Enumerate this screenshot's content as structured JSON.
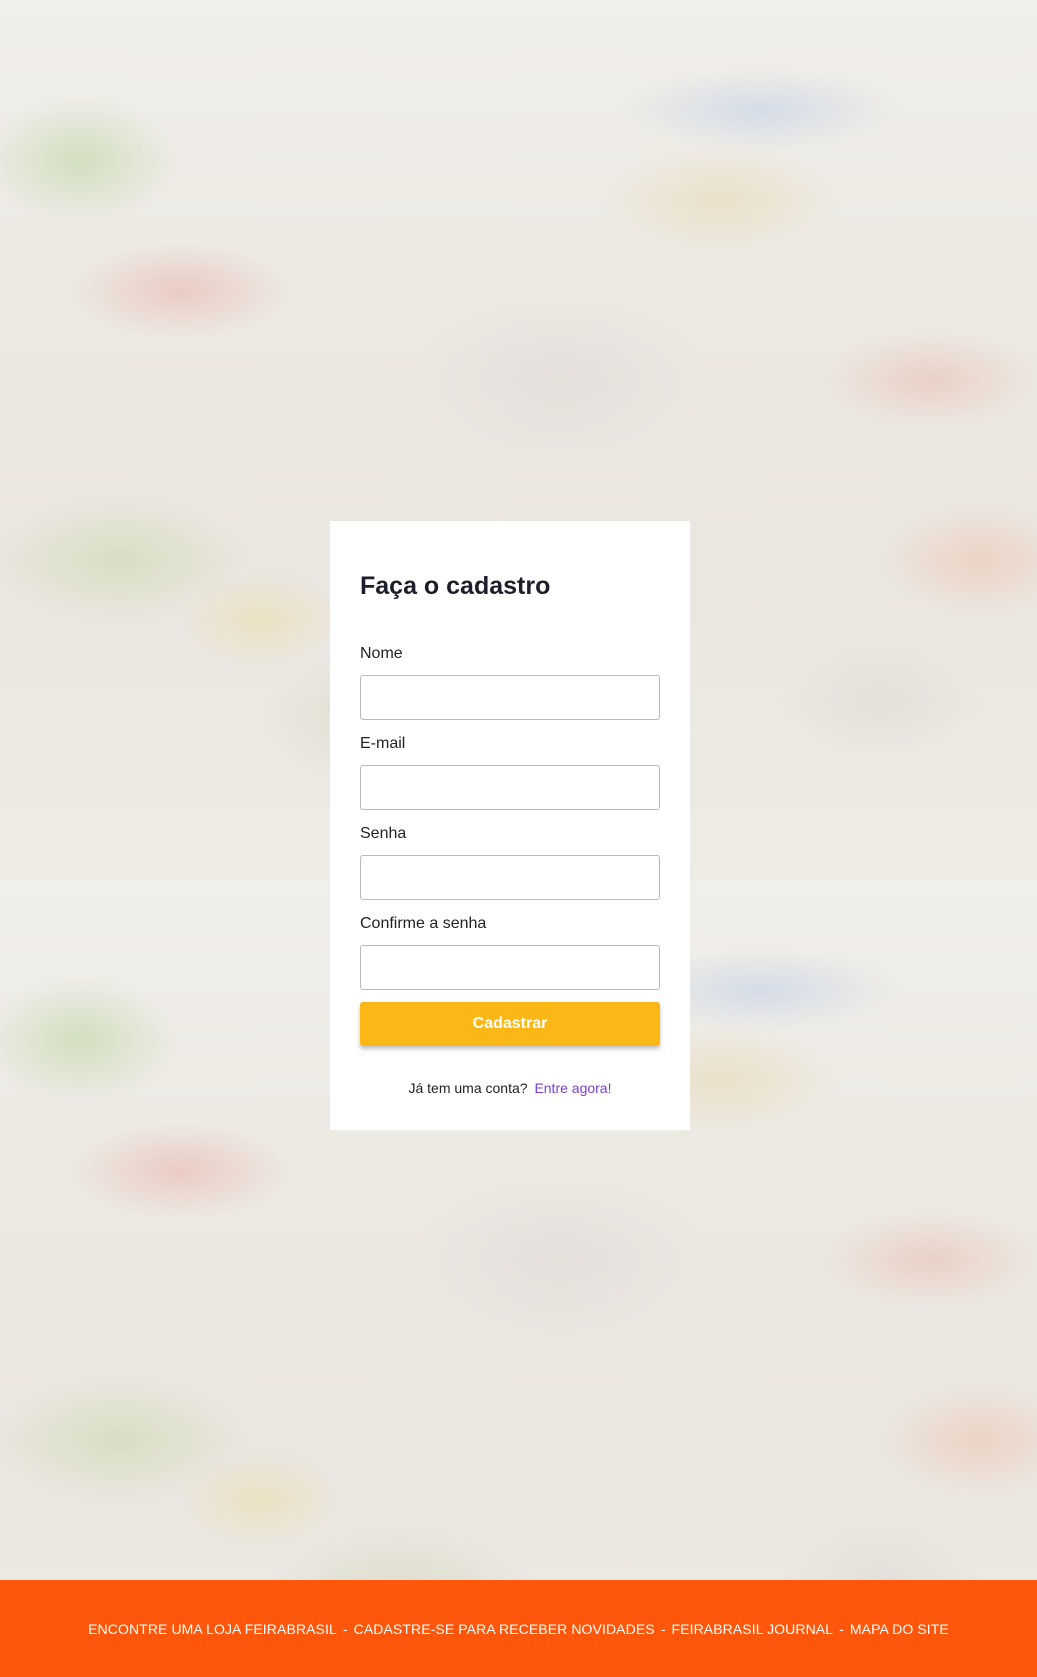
{
  "form": {
    "title": "Faça o cadastro",
    "fields": [
      {
        "label": "Nome",
        "value": "",
        "placeholder": ""
      },
      {
        "label": "E-mail",
        "value": "",
        "placeholder": ""
      },
      {
        "label": "Senha",
        "value": "",
        "placeholder": ""
      },
      {
        "label": "Confirme a senha",
        "value": "",
        "placeholder": ""
      }
    ],
    "submit_label": "Cadastrar",
    "signin_text": "Já tem uma conta?",
    "signin_link": "Entre agora!"
  },
  "footer": {
    "links": [
      "ENCONTRE UMA LOJA FEIRABRASIL",
      "CADASTRE-SE PARA RECEBER NOVIDADES",
      "FEIRABRASIL JOURNAL",
      "MAPA DO SITE"
    ],
    "separator": "-"
  },
  "colors": {
    "accent_button": "#fbb715",
    "footer_bg": "#fe560a",
    "link": "#7a3fd6"
  }
}
